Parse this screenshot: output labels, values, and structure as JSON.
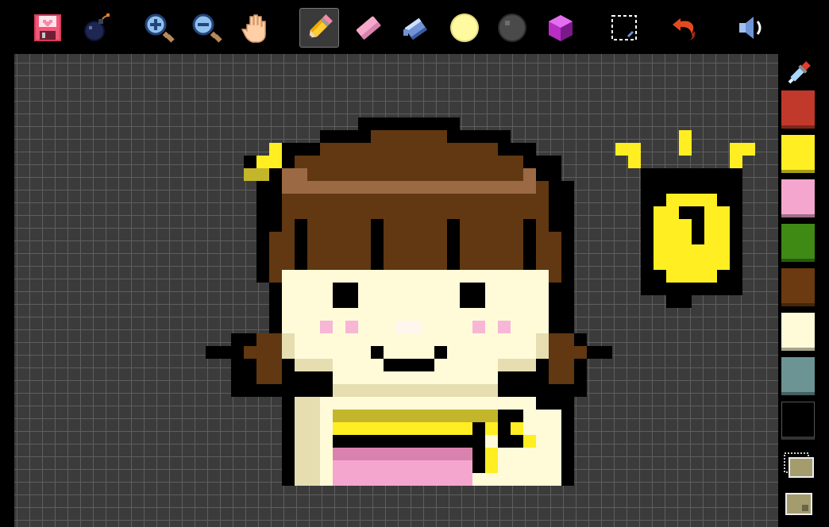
{
  "app": {
    "window_title": ""
  },
  "toolbar": {
    "tools": [
      {
        "id": "save",
        "icon": "floppy-disk-icon",
        "active": false
      },
      {
        "id": "clear",
        "icon": "bomb-icon",
        "active": false
      },
      {
        "id": "zoom_in",
        "icon": "zoom-in-icon",
        "active": false
      },
      {
        "id": "zoom_out",
        "icon": "zoom-out-icon",
        "active": false
      },
      {
        "id": "pan",
        "icon": "hand-icon",
        "active": false
      },
      {
        "id": "pencil",
        "icon": "pencil-icon",
        "active": true
      },
      {
        "id": "eraser",
        "icon": "eraser-icon",
        "active": false
      },
      {
        "id": "fill",
        "icon": "paint-bucket-icon",
        "active": false
      },
      {
        "id": "light_color",
        "icon": "light-circle-icon",
        "active": false
      },
      {
        "id": "dark_color",
        "icon": "dark-circle-icon",
        "active": false
      },
      {
        "id": "cube",
        "icon": "cube-icon",
        "active": false
      },
      {
        "id": "select",
        "icon": "selection-icon",
        "active": false
      },
      {
        "id": "undo",
        "icon": "undo-arrow-icon",
        "active": false
      },
      {
        "id": "sound",
        "icon": "speaker-icon",
        "active": false
      }
    ]
  },
  "palette": {
    "eyedropper_icon": "eyedropper-icon",
    "colors": [
      "#c0392b",
      "#ffee22",
      "#f4a6cf",
      "#3e8a14",
      "#6b3a10",
      "#fffbd8",
      "#6c9494",
      "#000000"
    ],
    "selected_index": 7,
    "bottom_tools": [
      "layers-icon",
      "frame-icon"
    ]
  },
  "canvas": {
    "grid": true,
    "art_colors": {
      "outline": "#000000",
      "hair": "#613811",
      "hair_highlight": "#9b6a44",
      "skin": "#fffbd8",
      "skin_shadow": "#e6ddb1",
      "blush": "#f7b6d6",
      "nose": "#fff7ee",
      "yellow": "#ffee22",
      "yellow_dark": "#c4b62a",
      "pink": "#f4a6cf",
      "pink_dark": "#d982ae"
    }
  }
}
